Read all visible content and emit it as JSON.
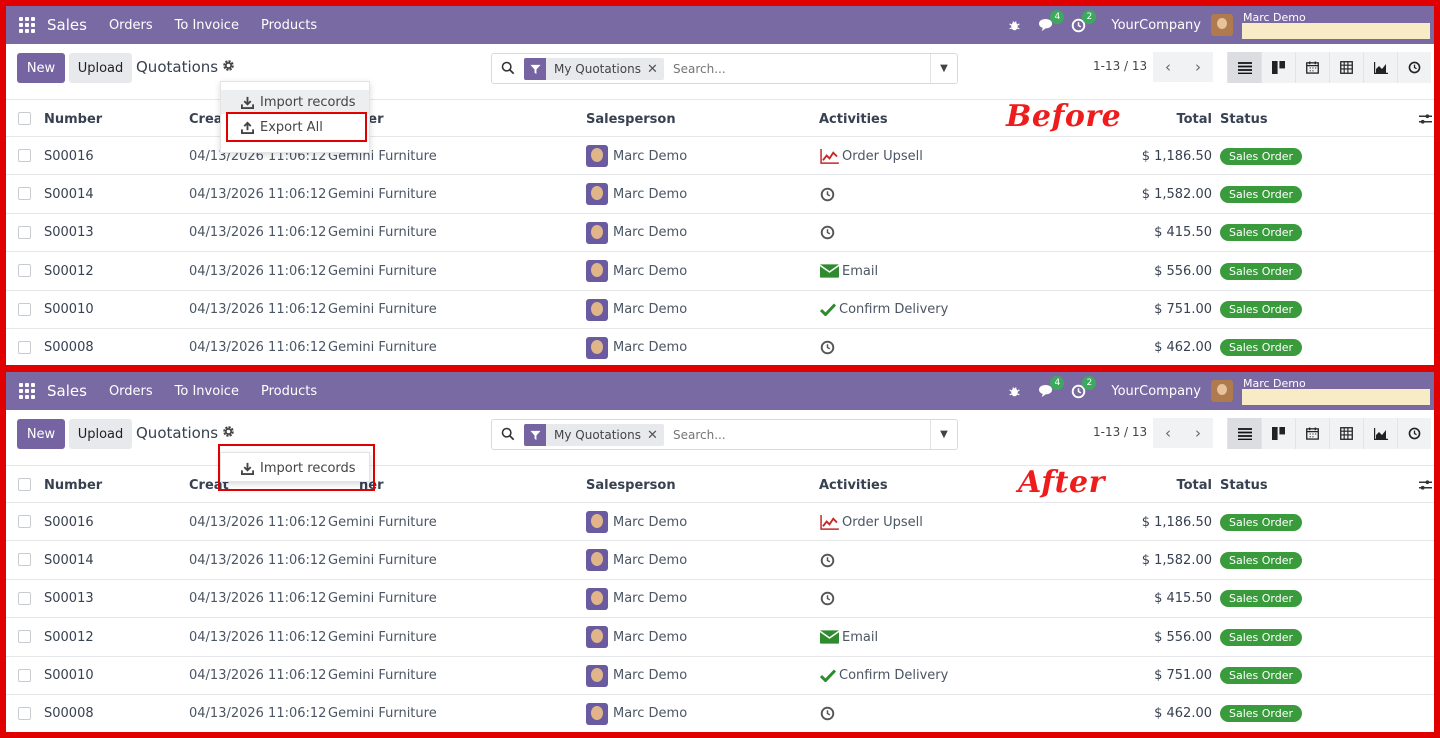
{
  "navbar": {
    "app_name": "Sales",
    "menu": [
      "Orders",
      "To Invoice",
      "Products"
    ],
    "messages_badge": "4",
    "activities_badge": "2",
    "company": "YourCompany",
    "user": "Marc Demo"
  },
  "control": {
    "new_label": "New",
    "upload_label": "Upload",
    "title": "Quotations",
    "facet_label": "My Quotations",
    "search_placeholder": "Search...",
    "pager": "1-13 / 13"
  },
  "columns": {
    "number": "Number",
    "created": "Creat",
    "customer": "her",
    "salesperson": "Salesperson",
    "activities": "Activities",
    "total": "Total",
    "status": "Status"
  },
  "rows": [
    {
      "number": "S00016",
      "date": "04/13/2026 11:06:12",
      "customer": "Gemini Furniture",
      "salesperson": "Marc Demo",
      "activity": "Order Upsell",
      "activity_icon": "chart-line-icon",
      "total": "$ 1,186.50",
      "status": "Sales Order"
    },
    {
      "number": "S00014",
      "date": "04/13/2026 11:06:12",
      "customer": "Gemini Furniture",
      "salesperson": "Marc Demo",
      "activity": "",
      "activity_icon": "clock-icon",
      "total": "$ 1,582.00",
      "status": "Sales Order"
    },
    {
      "number": "S00013",
      "date": "04/13/2026 11:06:12",
      "customer": "Gemini Furniture",
      "salesperson": "Marc Demo",
      "activity": "",
      "activity_icon": "clock-icon",
      "total": "$ 415.50",
      "status": "Sales Order"
    },
    {
      "number": "S00012",
      "date": "04/13/2026 11:06:12",
      "customer": "Gemini Furniture",
      "salesperson": "Marc Demo",
      "activity": "Email",
      "activity_icon": "envelope-icon",
      "total": "$ 556.00",
      "status": "Sales Order"
    },
    {
      "number": "S00010",
      "date": "04/13/2026 11:06:12",
      "customer": "Gemini Furniture",
      "salesperson": "Marc Demo",
      "activity": "Confirm Delivery",
      "activity_icon": "check-icon",
      "total": "$ 751.00",
      "status": "Sales Order"
    },
    {
      "number": "S00008",
      "date": "04/13/2026 11:06:12",
      "customer": "Gemini Furniture",
      "salesperson": "Marc Demo",
      "activity": "",
      "activity_icon": "clock-icon",
      "total": "$ 462.00",
      "status": "Sales Order"
    }
  ],
  "before": {
    "annotation": "Before",
    "dropdown": [
      "Import records",
      "Export All"
    ]
  },
  "after": {
    "annotation": "After",
    "dropdown": [
      "Import records"
    ]
  },
  "colors": {
    "navbar": "#7a6aa3",
    "primary": "#7563a2",
    "status_green": "#3a9b3d",
    "annotation_red": "#ee1c1c"
  }
}
